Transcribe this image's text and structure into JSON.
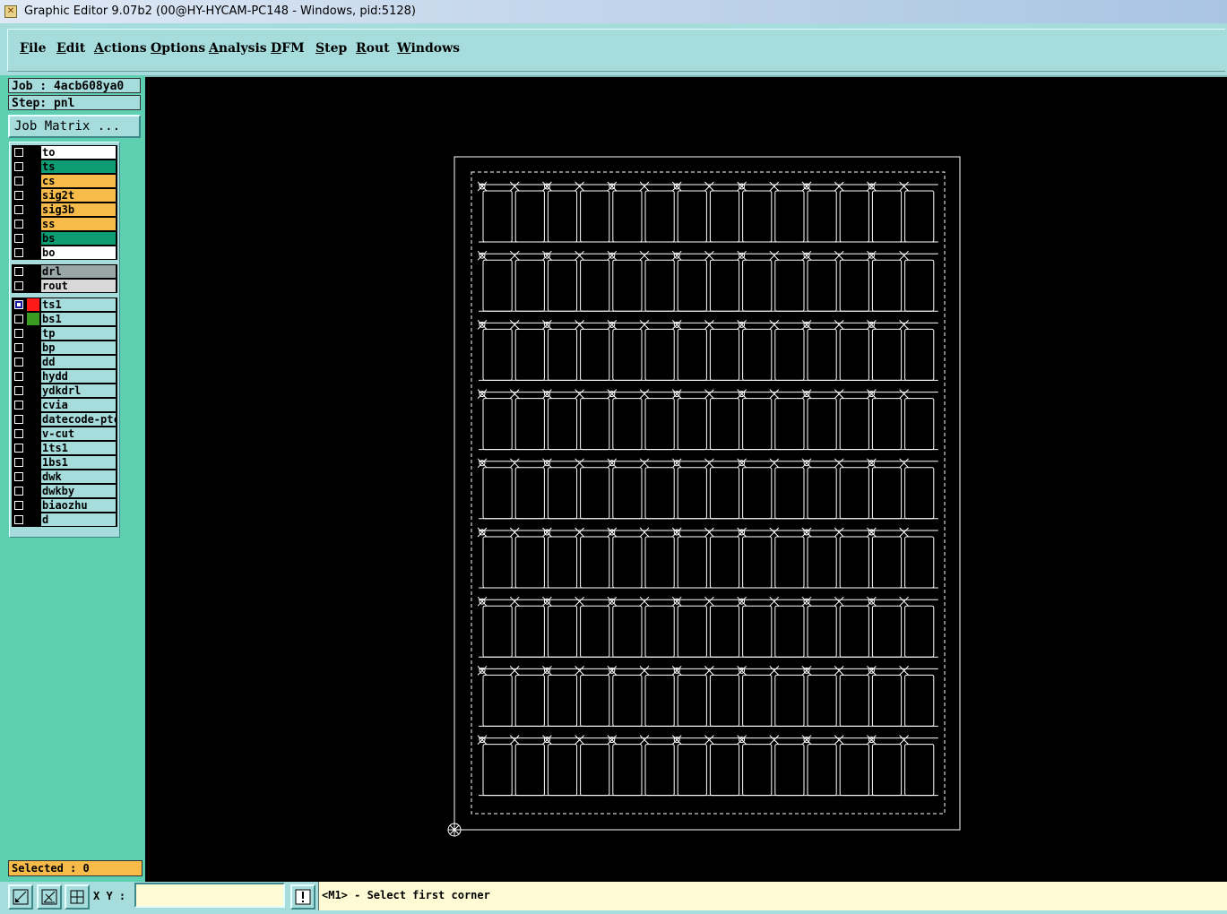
{
  "window": {
    "title": "Graphic Editor 9.07b2 (00@HY-HYCAM-PC148 - Windows, pid:5128)"
  },
  "menu": [
    "File",
    "Edit",
    "Actions",
    "Options",
    "Analysis",
    "DFM",
    "Step",
    "Rout",
    "Windows"
  ],
  "job": {
    "label": "Job : 4acb608ya0",
    "step": "Step: pnl",
    "matrix_button": "Job Matrix ..."
  },
  "layers": {
    "board": [
      {
        "name": "to",
        "color": "#ffffff"
      },
      {
        "name": "ts",
        "color": "#0e9c74"
      },
      {
        "name": "cs",
        "color": "#f6bb49"
      },
      {
        "name": "sig2t",
        "color": "#f6bb49"
      },
      {
        "name": "sig3b",
        "color": "#f6bb49"
      },
      {
        "name": "ss",
        "color": "#f6bb49"
      },
      {
        "name": "bs",
        "color": "#0e9c74"
      },
      {
        "name": "bo",
        "color": "#ffffff"
      }
    ],
    "drill": [
      {
        "name": "drl",
        "color": "#9aa7a7"
      },
      {
        "name": "rout",
        "color": "#d8d8d8"
      }
    ],
    "misc": [
      {
        "name": "ts1",
        "color": "#a6dcdc",
        "swatch": "#ff1a1a",
        "checkbox": "#1a1aa0"
      },
      {
        "name": "bs1",
        "color": "#a6dcdc",
        "swatch": "#3a9c20"
      },
      {
        "name": "tp",
        "color": "#a6dcdc"
      },
      {
        "name": "bp",
        "color": "#a6dcdc"
      },
      {
        "name": "dd",
        "color": "#a6dcdc"
      },
      {
        "name": "hydd",
        "color": "#a6dcdc"
      },
      {
        "name": "ydkdrl",
        "color": "#a6dcdc"
      },
      {
        "name": "cvia",
        "color": "#a6dcdc"
      },
      {
        "name": "datecode-ptc",
        "color": "#a6dcdc"
      },
      {
        "name": "v-cut",
        "color": "#a6dcdc"
      },
      {
        "name": "1ts1",
        "color": "#a6dcdc"
      },
      {
        "name": "1bs1",
        "color": "#a6dcdc"
      },
      {
        "name": "dwk",
        "color": "#a6dcdc"
      },
      {
        "name": "dwkby",
        "color": "#a6dcdc"
      },
      {
        "name": "biaozhu",
        "color": "#a6dcdc"
      },
      {
        "name": "d",
        "color": "#a6dcdc"
      }
    ]
  },
  "selected": "Selected : 0",
  "status": {
    "xy_label": "X Y :",
    "xy_value": "",
    "prompt": "<M1> - Select first corner",
    "buttons": [
      "snap-icon",
      "measure-icon",
      "grid-icon"
    ],
    "alert_icon": "exclamation-icon"
  },
  "panel_grid": {
    "columns": 14,
    "rows": 9
  },
  "colors": {
    "accent": "#a6dcdc",
    "panel": "#5ecfb0",
    "canvas": "#000000",
    "highlight": "#f6bb49"
  }
}
